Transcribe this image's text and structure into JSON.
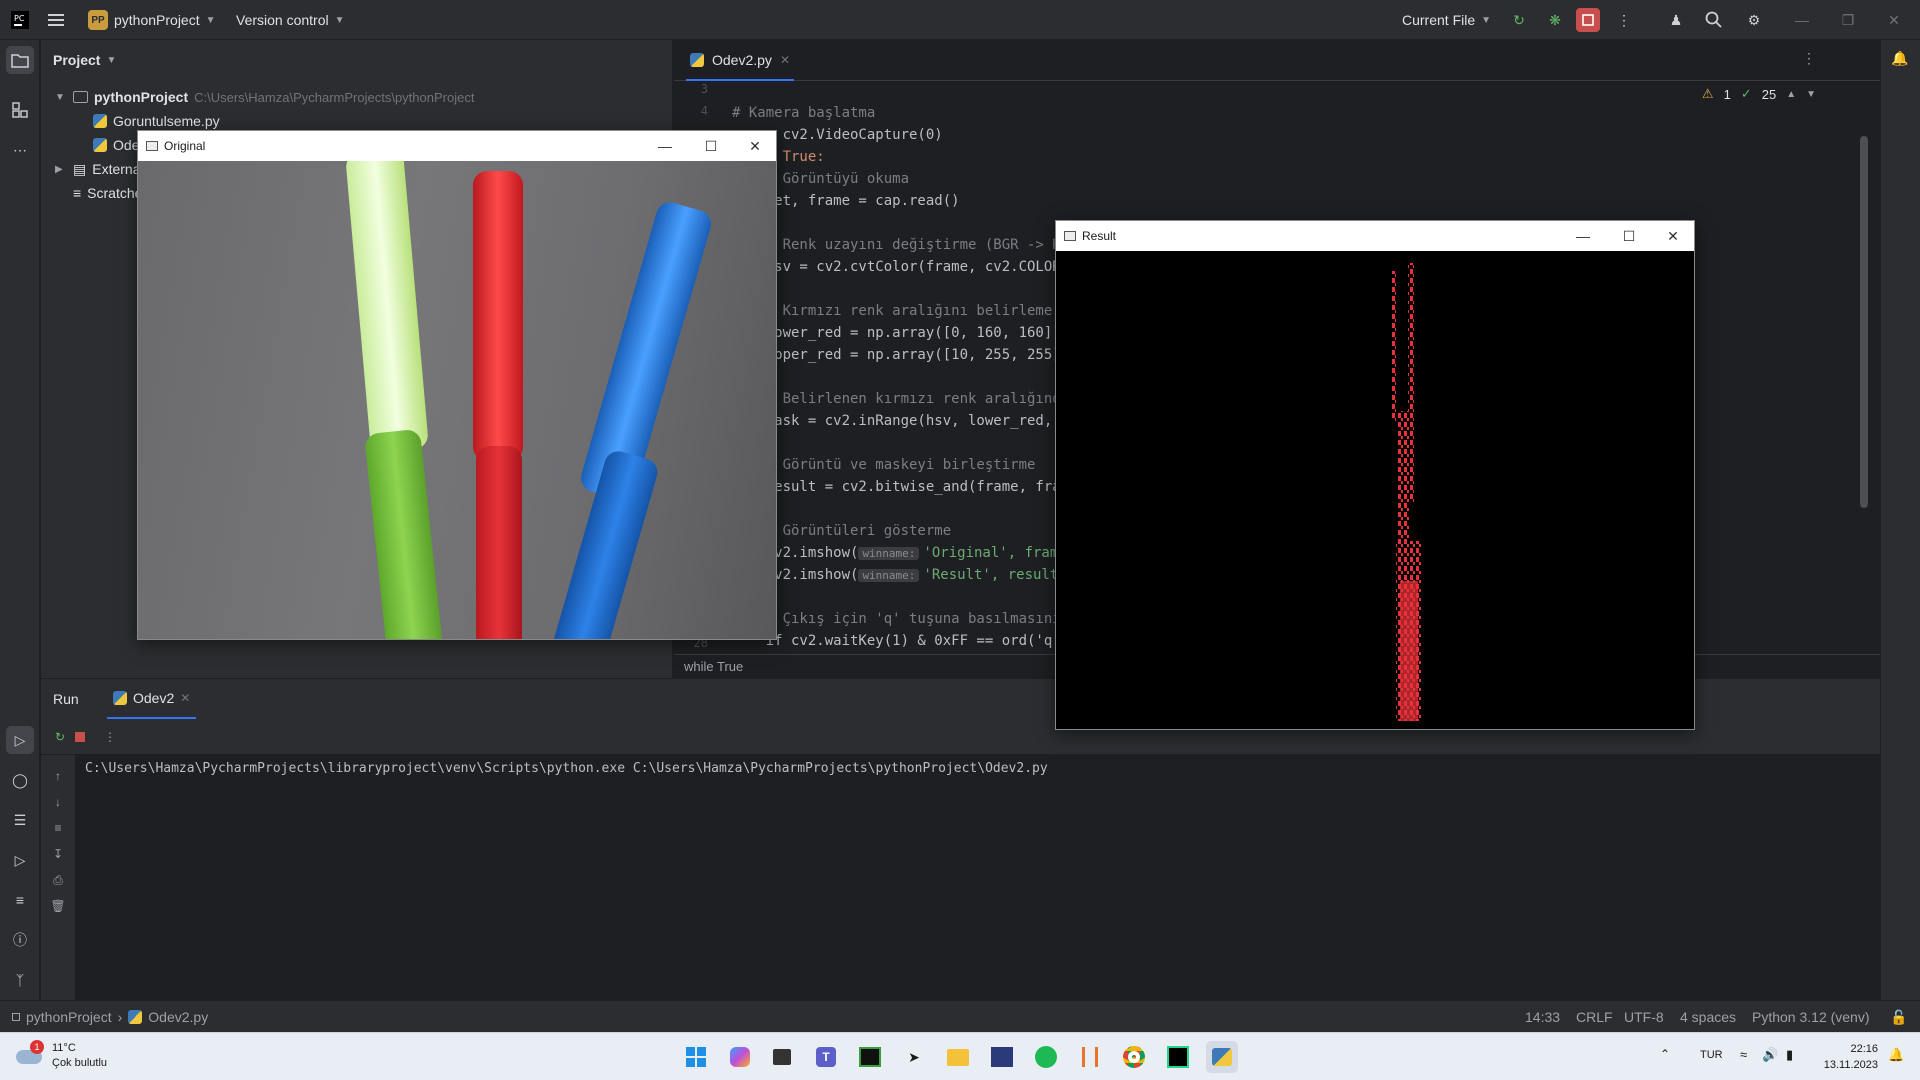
{
  "titlebar": {
    "project_badge": "PP",
    "project_name": "pythonProject",
    "vcs": "Version control",
    "run_config": "Current File"
  },
  "project_panel": {
    "header": "Project",
    "root_name": "pythonProject",
    "root_path": "C:\\Users\\Hamza\\PycharmProjects\\pythonProject",
    "files": [
      "Goruntulseme.py",
      "Odev2.py"
    ],
    "external": "External Libraries",
    "scratches": "Scratches and Consoles"
  },
  "editor": {
    "tab": "Odev2.py",
    "inspection_warnings": "1",
    "inspection_ok": "25",
    "breadcrumb": "while True",
    "gutter": [
      "3",
      "4",
      "",
      "",
      "",
      "",
      "",
      "",
      "",
      "",
      "",
      "",
      "",
      "",
      "",
      "",
      "",
      "",
      "",
      "",
      "",
      "",
      "",
      "28"
    ],
    "lines": {
      "l1": "# Kamera başlatma",
      "l2": "cap = cv2.VideoCapture(0)",
      "l3": "while True:",
      "l4": "    # Görüntüyü okuma",
      "l5": "    ret, frame = cap.read()",
      "l7": "    # Renk uzayını değiştirme (BGR -> HSV)",
      "l8": "    hsv = cv2.cvtColor(frame, cv2.COLOR_BGR2HSV)",
      "l10": "    # Kırmızı renk aralığını belirleme",
      "l11": "    lower_red = np.array([0, 160, 160])",
      "l12": "    upper_red = np.array([10, 255, 255])",
      "l14": "    # Belirlenen kırmızı renk aralığındaki",
      "l15": "    mask = cv2.inRange(hsv, lower_red, upper_red)",
      "l17": "    # Görüntü ve maskeyi birleştirme",
      "l18": "    result = cv2.bitwise_and(frame, frame, mask=mask)",
      "l20": "    # Görüntüleri gösterme",
      "l21a": "    cv2.imshow(",
      "l21b": "'Original', frame)",
      "l22a": "    cv2.imshow(",
      "l22b": "'Result', result)",
      "l24": "    # Çıkış için 'q' tuşuna basılmasını bekleme",
      "l25": "    if cv2.waitKey(1) & 0xFF == ord('q'):",
      "hint": "winname:"
    }
  },
  "run": {
    "tab_run": "Run",
    "tab_config": "Odev2",
    "console": "C:\\Users\\Hamza\\PycharmProjects\\libraryproject\\venv\\Scripts\\python.exe C:\\Users\\Hamza\\PycharmProjects\\pythonProject\\Odev2.py"
  },
  "statusbar": {
    "project": "pythonProject",
    "file": "Odev2.py",
    "position": "14:33",
    "line_sep": "CRLF",
    "encoding": "UTF-8",
    "indent": "4 spaces",
    "interpreter": "Python 3.12 (venv)"
  },
  "windows": {
    "original_title": "Original",
    "result_title": "Result"
  },
  "taskbar": {
    "weather_temp": "11°C",
    "weather_desc": "Çok bulutlu",
    "weather_badge": "1",
    "lang": "TUR",
    "time": "22:16",
    "date": "13.11.2023"
  },
  "colors": {
    "accent": "#3574f0",
    "stop": "#c94f4f",
    "marker_green": "#7bc63f",
    "marker_red": "#d8262b",
    "marker_blue": "#1f74d6"
  }
}
